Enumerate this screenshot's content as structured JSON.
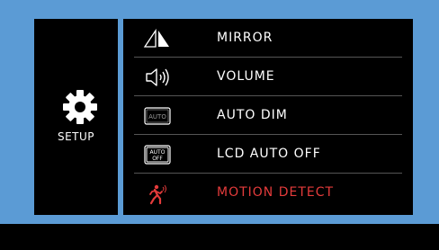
{
  "side": {
    "label": "SETUP",
    "icon": "gear-icon"
  },
  "menu": {
    "items": [
      {
        "label": "MIRROR",
        "icon": "mirror-icon"
      },
      {
        "label": "VOLUME",
        "icon": "volume-icon"
      },
      {
        "label": "AUTO DIM",
        "icon": "auto-dim-icon",
        "icon_text": "AUTO"
      },
      {
        "label": "LCD AUTO OFF",
        "icon": "lcd-auto-off-icon",
        "icon_text_1": "AUTO",
        "icon_text_2": "OFF"
      },
      {
        "label": "MOTION DETECT",
        "icon": "motion-detect-icon",
        "active": true
      }
    ]
  },
  "colors": {
    "frame": "#5b9bd5",
    "panel": "#000000",
    "text": "#ffffff",
    "active": "#e43b3b"
  }
}
